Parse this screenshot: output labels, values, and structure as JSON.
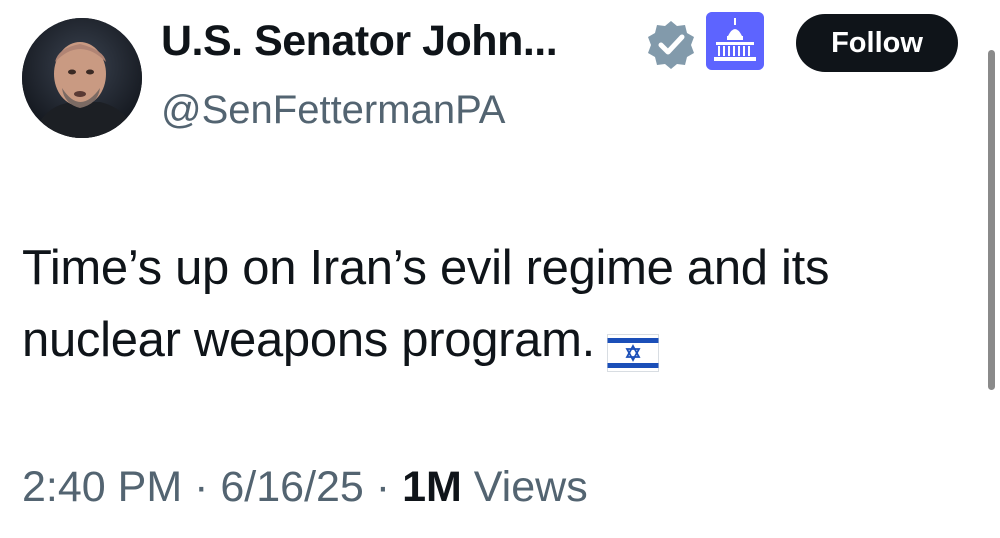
{
  "author": {
    "display_name": "U.S. Senator John...",
    "handle": "@SenFettermanPA",
    "verified_icon": "verified-badge-icon",
    "affiliation_icon": "us-capitol-icon"
  },
  "follow_button": {
    "label": "Follow"
  },
  "tweet": {
    "text": "Time’s up on Iran’s evil regime and its nuclear weapons program.",
    "emoji": "israel-flag-icon"
  },
  "meta": {
    "time": "2:40 PM",
    "separator": "·",
    "date": "6/16/25",
    "views_count": "1M",
    "views_label": "Views"
  },
  "colors": {
    "text_primary": "#0f1419",
    "text_secondary": "#536471",
    "verified_badge": "#829aab",
    "follow_bg": "#0f1419",
    "affiliation_bg": "#6a5cff"
  }
}
